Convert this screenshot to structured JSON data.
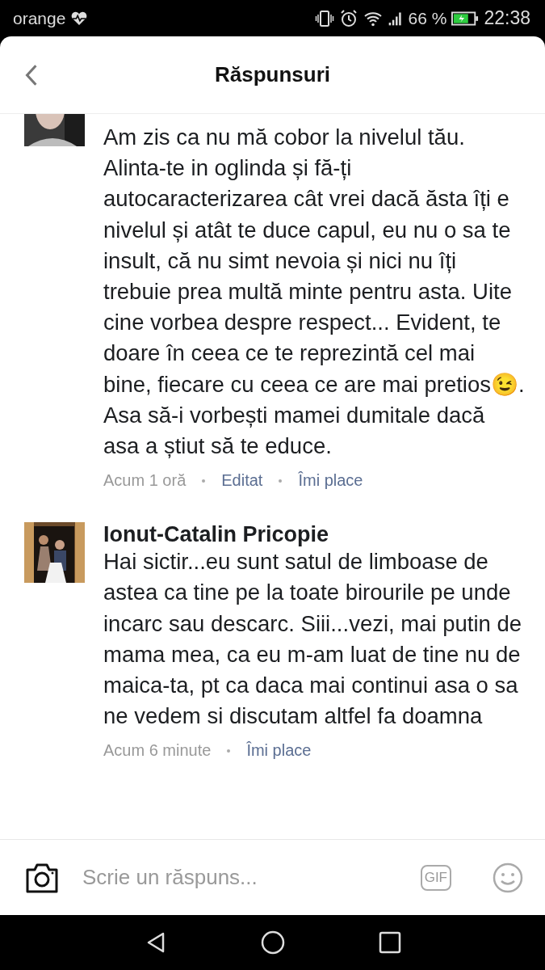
{
  "status_bar": {
    "carrier": "orange",
    "battery_percent": "66 %",
    "time": "22:38"
  },
  "header": {
    "title": "Răspunsuri"
  },
  "comments": [
    {
      "text": "Am zis ca nu mă cobor la nivelul tău. Alinta-te in oglinda și fă-ți autocaracterizarea cât vrei dacă ăsta îți e nivelul și atât te duce capul, eu nu o sa te insult, că nu simt nevoia și nici nu îți trebuie prea multă minte pentru asta. Uite cine vorbea despre respect... Evident, te doare în ceea ce te reprezintă cel mai bine, fiecare cu ceea ce are mai pretios😉. Asa să-i vorbești mamei dumitale dacă asa a știut să te educe.",
      "time": "Acum 1 oră",
      "actions": [
        "Editat",
        "Îmi place"
      ]
    },
    {
      "author": "Ionut-Catalin Pricopie",
      "text": "Hai sictir...eu sunt satul de limboase de astea ca tine pe la toate birourile pe unde incarc sau descarc. Siii...vezi, mai putin de mama mea, ca eu m-am luat de tine nu de maica-ta, pt ca daca mai continui asa o sa ne vedem si discutam altfel fa doamna",
      "time": "Acum 6 minute",
      "actions": [
        "Îmi place"
      ]
    }
  ],
  "composer": {
    "placeholder": "Scrie un răspuns...",
    "gif_label": "GIF"
  }
}
